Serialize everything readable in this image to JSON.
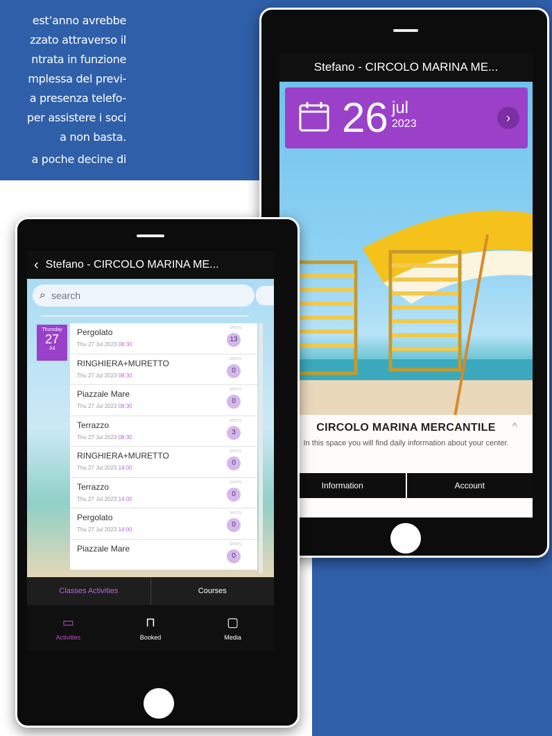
{
  "article": {
    "lines": [
      "est’anno avrebbe",
      "zzato attraverso il",
      "ntrata in funzione",
      "mplessa del previ-",
      "a presenza telefo-",
      "per assistere i soci",
      "a non basta."
    ],
    "line2": "a poche decine di"
  },
  "right_phone": {
    "header_title": "Stefano - CIRCOLO MARINA ME...",
    "date": {
      "day": "26",
      "month": "jul",
      "year": "2023"
    },
    "next_glyph": "›",
    "info": {
      "title": "CIRCOLO MARINA MERCANTILE",
      "collapse_glyph": "^",
      "description": "In this space you will find daily information about your center.",
      "buttons": [
        "Information",
        "Account"
      ]
    }
  },
  "left_phone": {
    "header_title": "Stefano - CIRCOLO MARINA ME...",
    "back_glyph": "‹",
    "search_placeholder": "search",
    "search_glyph": "⌕",
    "day_tile": {
      "weekday": "Thursday",
      "day": "27",
      "month": "Jul"
    },
    "spots_label": "SPOTS",
    "activities": [
      {
        "name": "Pergolato",
        "date": "Thu 27 Jul 2023",
        "time": "08:30",
        "spots": "13"
      },
      {
        "name": "RINGHIERA+MURETTO",
        "date": "Thu 27 Jul 2023",
        "time": "08:30",
        "spots": "0"
      },
      {
        "name": "Piazzale Mare",
        "date": "Thu 27 Jul 2023",
        "time": "08:30",
        "spots": "0"
      },
      {
        "name": "Terrazzo",
        "date": "Thu 27 Jul 2023",
        "time": "08:30",
        "spots": "3"
      },
      {
        "name": "RINGHIERA+MURETTO",
        "date": "Thu 27 Jul 2023",
        "time": "14:00",
        "spots": "0"
      },
      {
        "name": "Terrazzo",
        "date": "Thu 27 Jul 2023",
        "time": "14:00",
        "spots": "0"
      },
      {
        "name": "Pergolato",
        "date": "Thu 27 Jul 2023",
        "time": "14:00",
        "spots": "0"
      },
      {
        "name": "Piazzale Mare",
        "date": "",
        "time": "",
        "spots": "0"
      }
    ],
    "subtabs": [
      "Classes Activities",
      "Courses"
    ],
    "nav": [
      {
        "label": "Activities",
        "icon": "calendar-icon",
        "glyph": "▭"
      },
      {
        "label": "Booked",
        "icon": "bookmark-icon",
        "glyph": "⊓"
      },
      {
        "label": "Media",
        "icon": "video-icon",
        "glyph": "▢"
      }
    ]
  },
  "colors": {
    "page_blue": "#2f5fa8",
    "accent_purple": "#9b41c9",
    "active_magenta": "#c14ccd"
  }
}
